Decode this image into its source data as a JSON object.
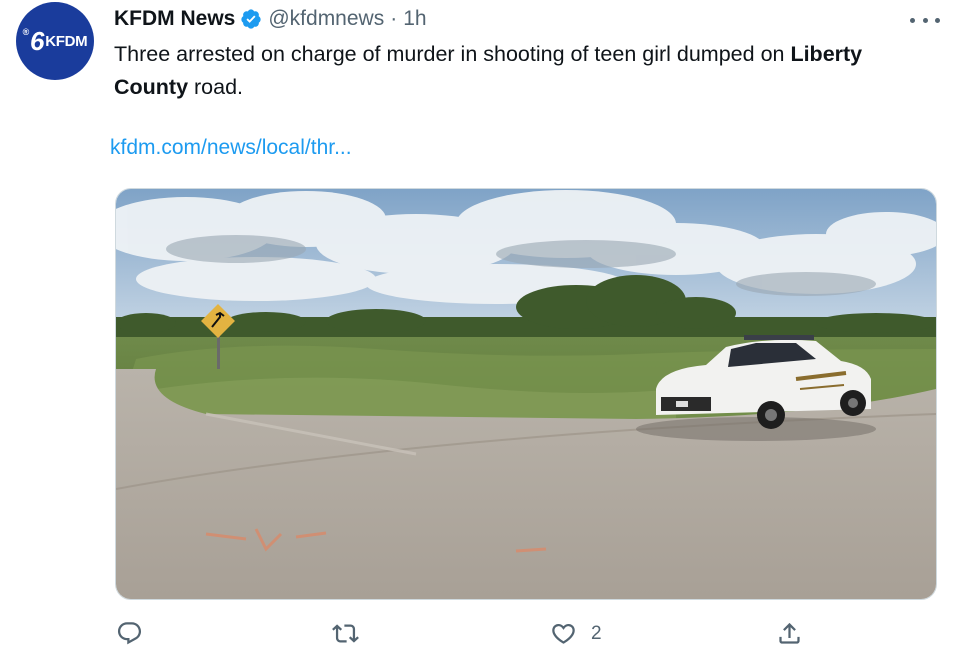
{
  "account": {
    "display_name": "KFDM News",
    "handle": "@kfdmnews",
    "separator": "·",
    "time": "1h",
    "avatar_text": "KFDM",
    "avatar_number": "6",
    "avatar_mark": "®"
  },
  "tweet": {
    "text_part1": "Three arrested on charge of murder in shooting of teen girl dumped on ",
    "text_bold": "Liberty County",
    "text_part2": " road.",
    "link_text": "kfdm.com/news/local/thr..."
  },
  "actions": {
    "reply_icon": "reply-icon",
    "retweet_icon": "retweet-icon",
    "like_icon": "heart-icon",
    "like_count": "2",
    "share_icon": "share-icon"
  },
  "colors": {
    "link": "#1d9bf0",
    "verified": "#1d9bf0",
    "secondary_text": "#536471",
    "avatar_bg": "#1a3c9c"
  }
}
